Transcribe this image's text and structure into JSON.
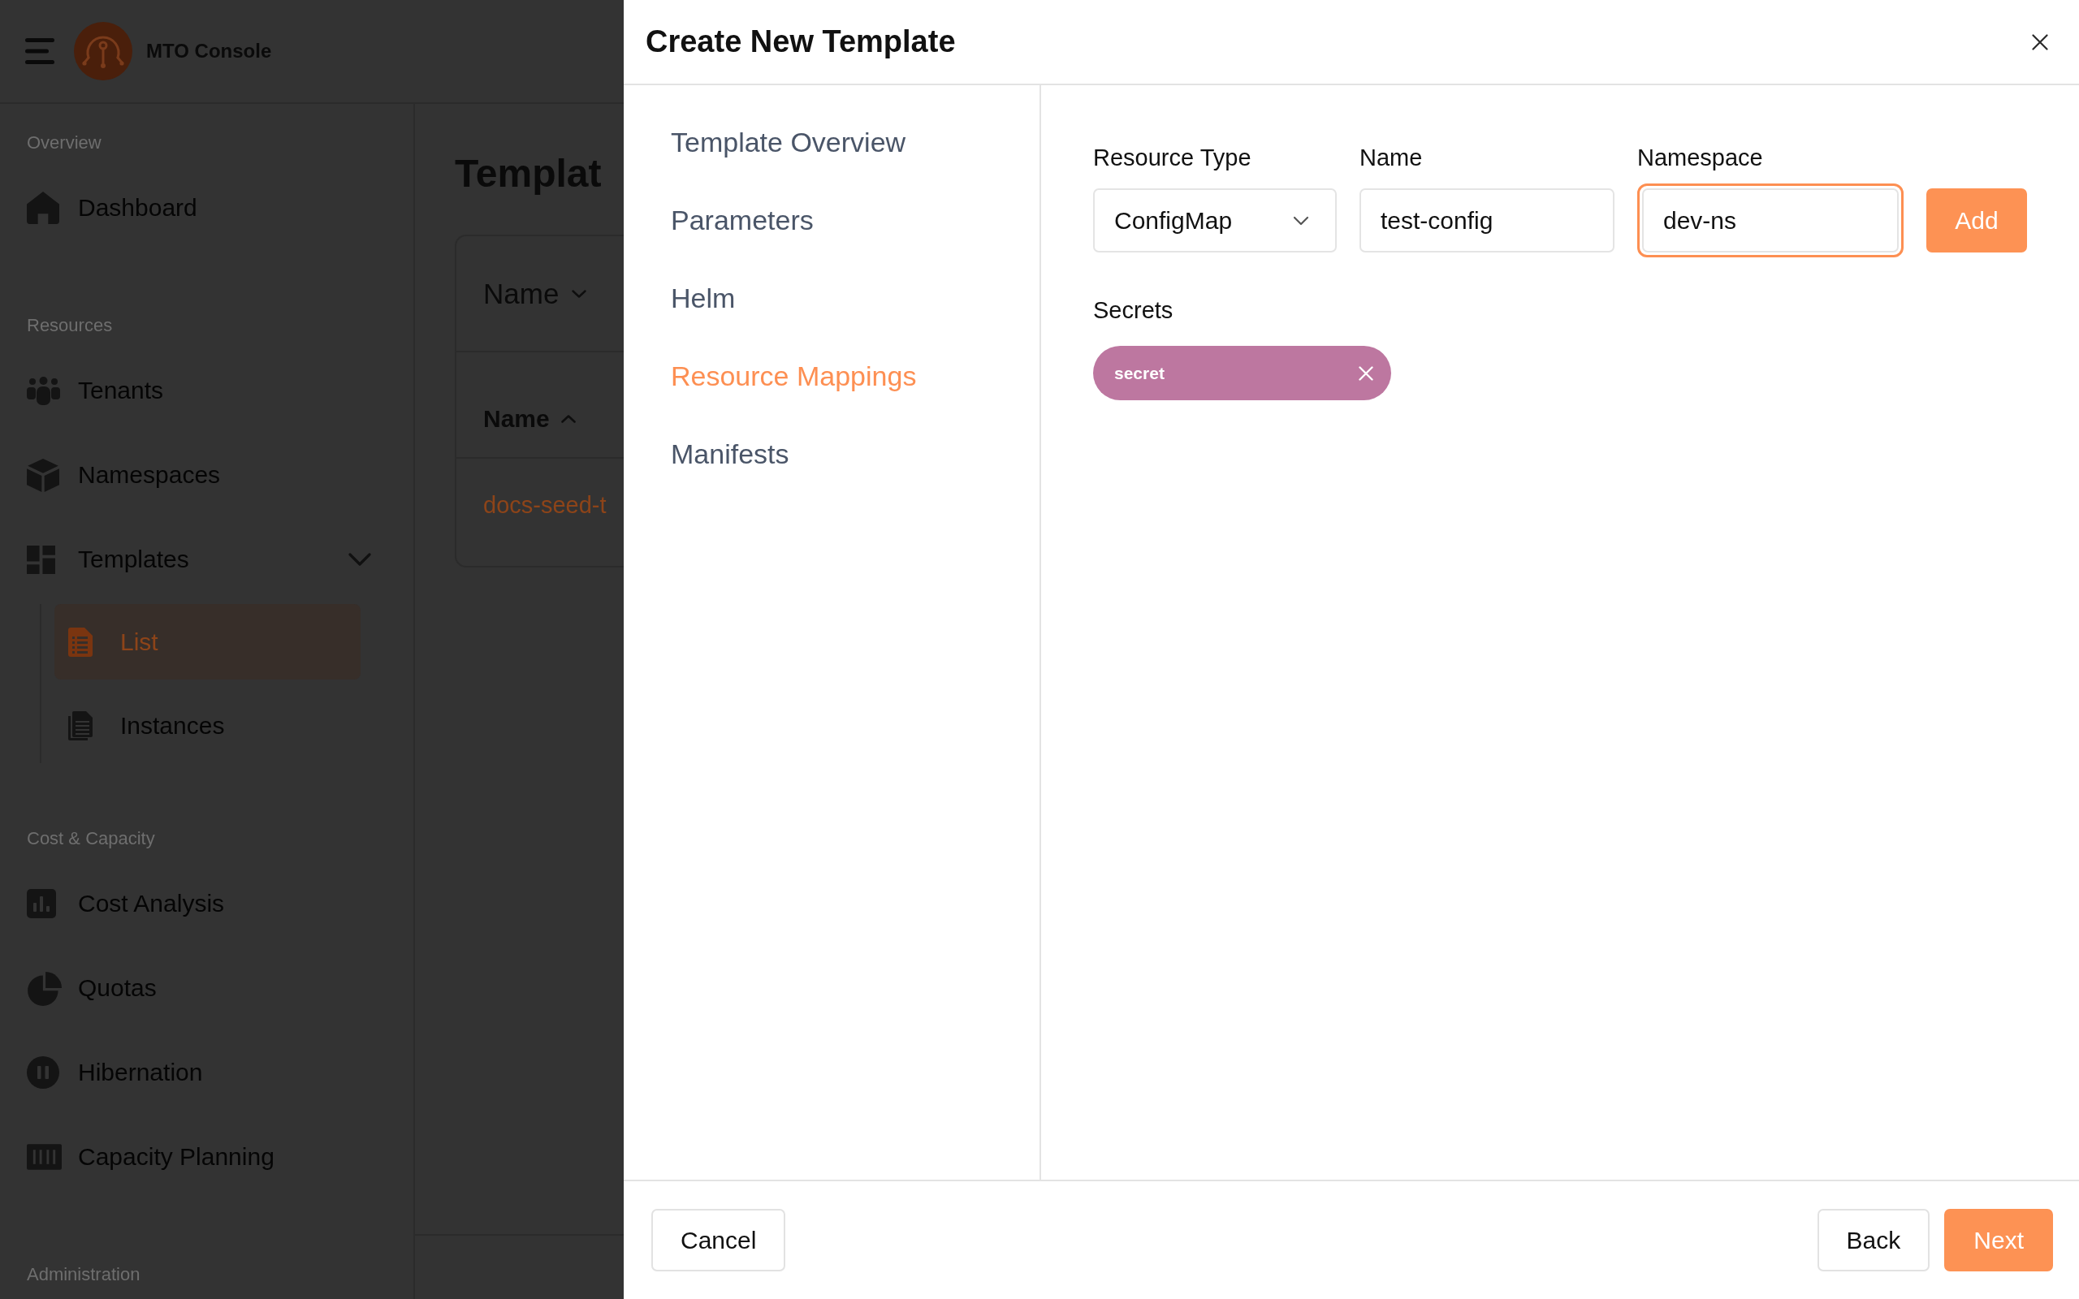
{
  "app": {
    "header": {
      "title": "MTO Console"
    },
    "sidebar": {
      "sections": [
        {
          "label": "Overview",
          "items": [
            {
              "label": "Dashboard",
              "selected": false
            }
          ]
        },
        {
          "label": "Resources",
          "items": [
            {
              "label": "Tenants",
              "selected": false
            },
            {
              "label": "Namespaces",
              "selected": false
            },
            {
              "label": "Templates",
              "selected": false,
              "expanded": true,
              "children": [
                {
                  "label": "List",
                  "selected": true
                },
                {
                  "label": "Instances",
                  "selected": false
                }
              ]
            }
          ]
        },
        {
          "label": "Cost & Capacity",
          "items": [
            {
              "label": "Cost Analysis",
              "selected": false
            },
            {
              "label": "Quotas",
              "selected": false
            },
            {
              "label": "Hibernation",
              "selected": false
            },
            {
              "label": "Capacity Planning",
              "selected": false
            }
          ]
        },
        {
          "label": "Administration"
        }
      ]
    },
    "page": {
      "title": "Templat",
      "filter": {
        "label": "Name"
      },
      "table": {
        "columns": [
          {
            "label": "Name",
            "sorted": true,
            "ascending": true
          }
        ],
        "rows": [
          {
            "cells": [
              "docs-seed-t"
            ]
          }
        ]
      }
    }
  },
  "dialog": {
    "title": "Create New Template",
    "steps": [
      {
        "label": "Template Overview",
        "selected": false
      },
      {
        "label": "Parameters",
        "selected": false
      },
      {
        "label": "Helm",
        "selected": false
      },
      {
        "label": "Resource Mappings",
        "selected": true
      },
      {
        "label": "Manifests",
        "selected": false
      }
    ],
    "fields": [
      {
        "kind": "select",
        "label": "Resource Type",
        "value": "ConfigMap",
        "focused": false
      },
      {
        "kind": "text",
        "label": "Name",
        "value": "test-config",
        "focused": false
      },
      {
        "kind": "text",
        "label": "Namespace",
        "value": "dev-ns",
        "focused": true
      }
    ],
    "add_button": {
      "label": "Add",
      "kind": "primary"
    },
    "secrets": {
      "label": "Secrets",
      "chips": [
        {
          "label": "secret"
        }
      ]
    },
    "footer": {
      "start": [
        {
          "label": "Cancel",
          "kind": "outline"
        }
      ],
      "end": [
        {
          "label": "Back",
          "kind": "outline"
        },
        {
          "label": "Next",
          "kind": "primary"
        }
      ]
    }
  }
}
